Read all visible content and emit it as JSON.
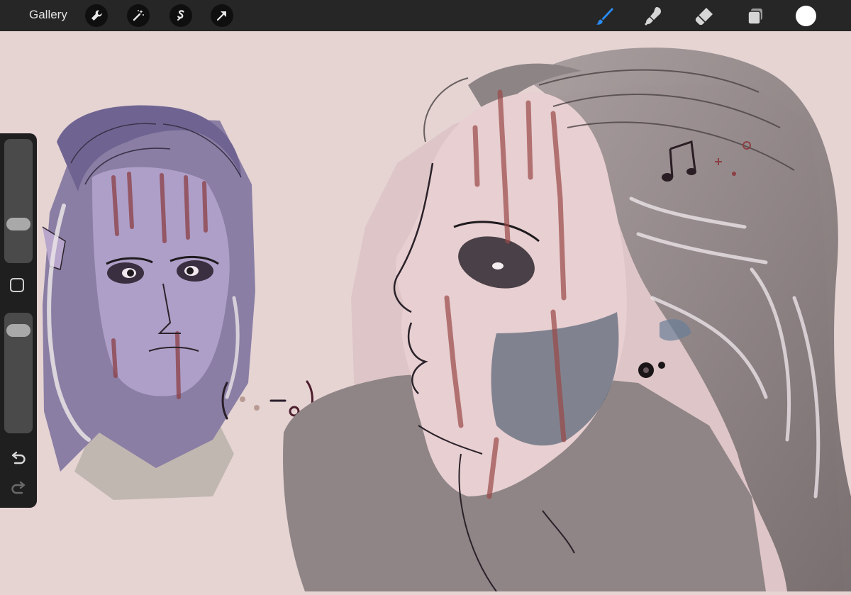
{
  "topbar": {
    "gallery_label": "Gallery",
    "left_tools": [
      "wrench-icon",
      "magic-wand-icon",
      "selection-icon",
      "move-arrow-icon"
    ],
    "right_tools": [
      "brush-icon",
      "smudge-icon",
      "eraser-icon",
      "layers-icon"
    ],
    "active_tool": "brush-icon",
    "current_color": "#ffffff"
  },
  "sidebar": {
    "brush_size": 0.28,
    "opacity": 0.92,
    "icons": [
      "undo-icon",
      "redo-icon"
    ]
  },
  "colors": {
    "background": "#e6d4d3",
    "toolbar": "#262626",
    "accent": "#2a8bf2"
  }
}
